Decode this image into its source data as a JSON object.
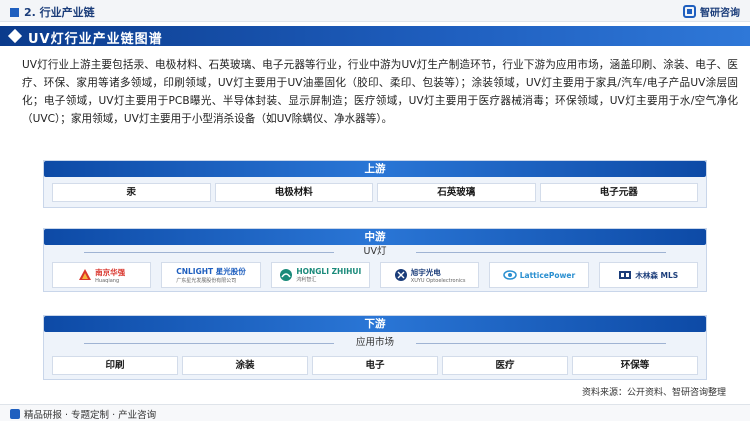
{
  "header": {
    "section_title": "2. 行业产业链",
    "brand_name": "智研咨询"
  },
  "banner": {
    "title": "UV灯行业产业链图谱"
  },
  "intro": {
    "text": "UV灯行业上游主要包括汞、电极材料、石英玻璃、电子元器等行业，行业中游为UV灯生产制造环节，行业下游为应用市场，涵盖印刷、涂装、电子、医疗、环保、家用等诸多领域，印刷领域，UV灯主要用于UV油墨固化（胶印、柔印、包装等）；涂装领域，UV灯主要用于家具/汽车/电子产品UV涂层固化；电子领域，UV灯主要用于PCB曝光、半导体封装、显示屏制造；医疗领域，UV灯主要用于医疗器械消毒；环保领域，UV灯主要用于水/空气净化（UVC）；家用领域，UV灯主要用于小型消杀设备（如UV除螨仪、净水器等）。"
  },
  "upstream": {
    "label": "上游",
    "items": [
      "汞",
      "电极材料",
      "石英玻璃",
      "电子元器"
    ]
  },
  "midstream": {
    "label": "中游",
    "sublabel": "UV灯",
    "companies": [
      {
        "name": "南京华强",
        "sub": "Huaqiang",
        "icon": "huaqiang-logo-icon",
        "color": "#d9342b"
      },
      {
        "name": "CNLIGHT 星光股份",
        "sub": "广东星光发展股份有限公司",
        "icon": "cnlight-logo-icon",
        "color": "#1f5fbf"
      },
      {
        "name": "HONGLI ZHIHUI",
        "sub": "鸿利智汇",
        "icon": "hongli-logo-icon",
        "color": "#1a8a7a"
      },
      {
        "name": "旭宇光电",
        "sub": "XUYU Optoelectronics",
        "icon": "xuyu-logo-icon",
        "color": "#1b3d7a"
      },
      {
        "name": "LatticePower",
        "sub": "",
        "icon": "latticepower-logo-icon",
        "color": "#2a8fd0"
      },
      {
        "name": "木林森 MLS",
        "sub": "",
        "icon": "mls-logo-icon",
        "color": "#1b3d7a"
      }
    ]
  },
  "downstream": {
    "label": "下游",
    "sublabel": "应用市场",
    "items": [
      "印刷",
      "涂装",
      "电子",
      "医疗",
      "环保等"
    ]
  },
  "footer": {
    "slogan": "精品研报 · 专题定制 · 产业咨询",
    "source": "资料来源：公开资料、智研咨询整理"
  },
  "colors": {
    "primary": "#1f5fbf",
    "dark": "#0b3b8c",
    "panel_bg": "#eef3fa"
  }
}
